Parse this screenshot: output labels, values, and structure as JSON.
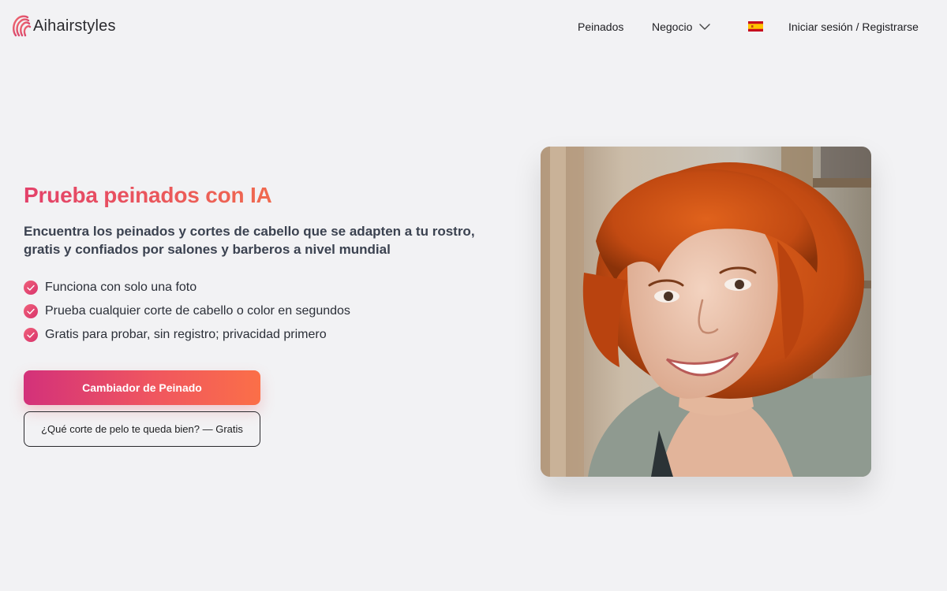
{
  "header": {
    "logo_text": "Aihairstyles",
    "nav": {
      "peinados": "Peinados",
      "negocio": "Negocio",
      "language_flag": "es-flag-icon",
      "login": "Iniciar sesión / Registrarse"
    }
  },
  "hero": {
    "title": "Prueba peinados con IA",
    "subtitle": "Encuentra los peinados y cortes de cabello que se adapten a tu rostro, gratis y confiados por salones y barberos a nivel mundial",
    "features": [
      "Funciona con solo una foto",
      "Prueba cualquier corte de cabello o color en segundos",
      "Gratis para probar, sin registro; privacidad primero"
    ],
    "primary_button": "Cambiador de Peinado",
    "secondary_button": "¿Qué corte de pelo te queda bien? — Gratis"
  },
  "colors": {
    "accent_start": "#d3317a",
    "accent_end": "#fb6f48",
    "background": "#f2f2f4"
  }
}
